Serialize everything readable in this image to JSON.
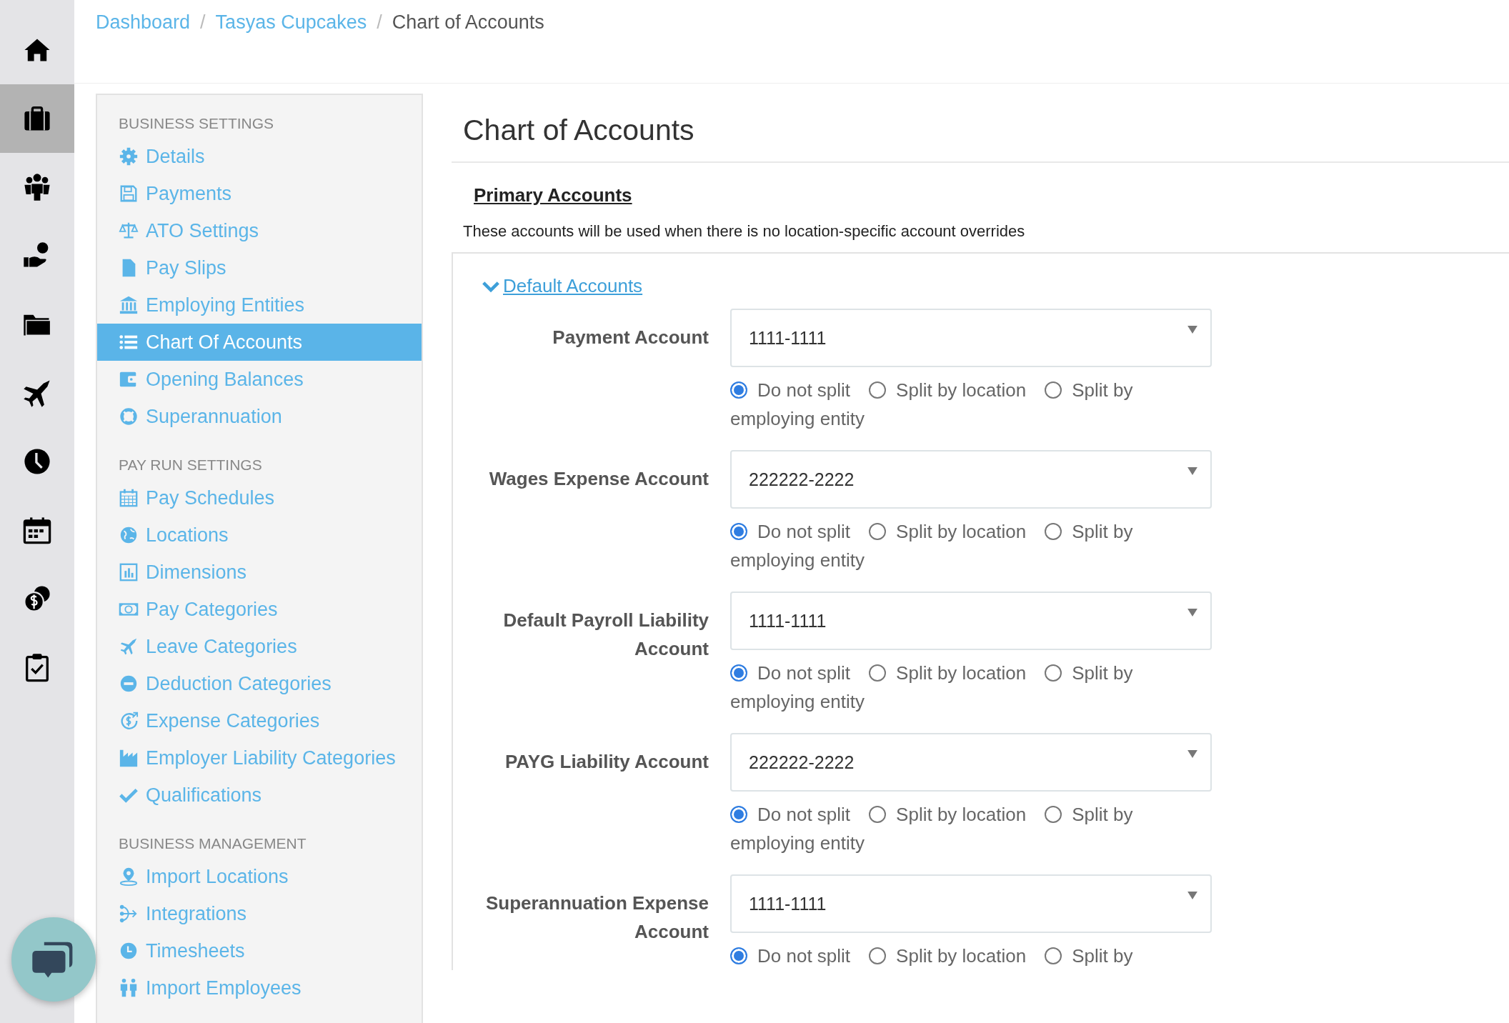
{
  "rail": [
    {
      "selected": false
    },
    {
      "selected": true
    },
    {
      "selected": false
    },
    {
      "selected": false
    },
    {
      "selected": false
    },
    {
      "selected": false
    },
    {
      "selected": false
    },
    {
      "selected": false
    },
    {
      "selected": false
    },
    {
      "selected": false
    }
  ],
  "breadcrumb": {
    "separator": "/",
    "items": [
      {
        "label": "Dashboard",
        "link": true
      },
      {
        "label": "Tasyas Cupcakes",
        "link": true
      },
      {
        "label": "Chart of Accounts",
        "link": false
      }
    ]
  },
  "sidebar": {
    "sections": [
      {
        "heading": "BUSINESS SETTINGS",
        "items": [
          {
            "label": "Details",
            "selected": false
          },
          {
            "label": "Payments",
            "selected": false
          },
          {
            "label": "ATO Settings",
            "selected": false
          },
          {
            "label": "Pay Slips",
            "selected": false
          },
          {
            "label": "Employing Entities",
            "selected": false
          },
          {
            "label": "Chart Of Accounts",
            "selected": true
          },
          {
            "label": "Opening Balances",
            "selected": false
          },
          {
            "label": "Superannuation",
            "selected": false
          }
        ]
      },
      {
        "heading": "PAY RUN SETTINGS",
        "items": [
          {
            "label": "Pay Schedules",
            "selected": false
          },
          {
            "label": "Locations",
            "selected": false
          },
          {
            "label": "Dimensions",
            "selected": false
          },
          {
            "label": "Pay Categories",
            "selected": false
          },
          {
            "label": "Leave Categories",
            "selected": false
          },
          {
            "label": "Deduction Categories",
            "selected": false
          },
          {
            "label": "Expense Categories",
            "selected": false
          },
          {
            "label": "Employer Liability Categories",
            "selected": false
          },
          {
            "label": "Qualifications",
            "selected": false
          }
        ]
      },
      {
        "heading": "BUSINESS MANAGEMENT",
        "items": [
          {
            "label": "Import Locations",
            "selected": false
          },
          {
            "label": "Integrations",
            "selected": false
          },
          {
            "label": "Timesheets",
            "selected": false
          },
          {
            "label": "Import Employees",
            "selected": false
          }
        ]
      }
    ]
  },
  "page": {
    "title": "Chart of Accounts",
    "section_title": "Primary Accounts",
    "description": "These accounts will be used when there is no location-specific account overrides",
    "group": {
      "label": "Default Accounts",
      "expanded": true,
      "accounts": [
        {
          "label": "Payment Account",
          "value": "1111-1111",
          "options": [
            {
              "lines": [
                "Do not split"
              ],
              "selected": true
            },
            {
              "lines": [
                "Split by location"
              ],
              "selected": false
            },
            {
              "lines": [
                "Split by",
                "employing entity"
              ],
              "selected": false
            }
          ]
        },
        {
          "label": "Wages Expense Account",
          "value": "222222-2222",
          "options": [
            {
              "lines": [
                "Do not split"
              ],
              "selected": true
            },
            {
              "lines": [
                "Split by location"
              ],
              "selected": false
            },
            {
              "lines": [
                "Split by",
                "employing entity"
              ],
              "selected": false
            }
          ]
        },
        {
          "label": "Default Payroll Liability Account",
          "value": "1111-1111",
          "options": [
            {
              "lines": [
                "Do not split"
              ],
              "selected": true
            },
            {
              "lines": [
                "Split by location"
              ],
              "selected": false
            },
            {
              "lines": [
                "Split by",
                "employing entity"
              ],
              "selected": false
            }
          ]
        },
        {
          "label": "PAYG Liability Account",
          "value": "222222-2222",
          "options": [
            {
              "lines": [
                "Do not split"
              ],
              "selected": true
            },
            {
              "lines": [
                "Split by location"
              ],
              "selected": false
            },
            {
              "lines": [
                "Split by",
                "employing entity"
              ],
              "selected": false
            }
          ]
        },
        {
          "label": "Superannuation Expense Account",
          "value": "1111-1111",
          "options": [
            {
              "lines": [
                "Do not split"
              ],
              "selected": true
            },
            {
              "lines": [
                "Split by location"
              ],
              "selected": false
            },
            {
              "lines": [
                "Split by"
              ],
              "selected": false
            }
          ]
        }
      ]
    }
  }
}
